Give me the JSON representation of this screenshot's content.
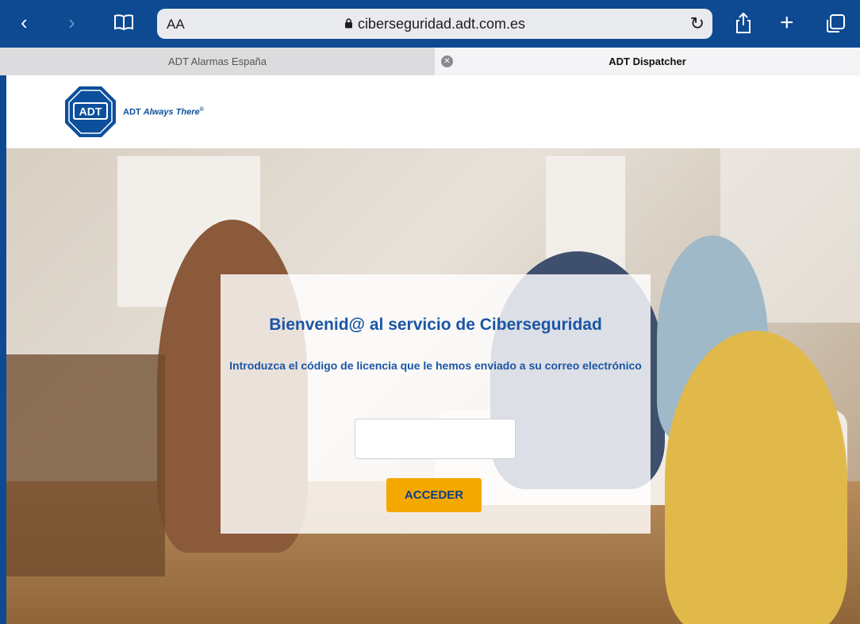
{
  "browser": {
    "text_size_label": "AA",
    "url": "ciberseguridad.adt.com.es",
    "tabs": [
      {
        "label": "ADT Alarmas España",
        "active": false
      },
      {
        "label": "ADT Dispatcher",
        "active": true
      }
    ],
    "icons": [
      "back-icon",
      "forward-icon",
      "bookmarks-icon",
      "lock-icon",
      "reload-icon",
      "share-icon",
      "new-tab-icon",
      "tabs-overview-icon",
      "tab-close-icon"
    ]
  },
  "header": {
    "logo_text": "ADT",
    "tagline_brand": "ADT",
    "tagline_slogan": "Always There",
    "tagline_mark": "®"
  },
  "login": {
    "title": "Bienvenid@ al servicio de Ciberseguridad",
    "instructions": "Introduzca el código de licencia que le hemos enviado a su correo electrónico",
    "code_value": "",
    "code_placeholder": "",
    "submit_label": "ACCEDER"
  },
  "colors": {
    "toolbar": "#0d4a92",
    "brand_blue": "#1b56a6",
    "button": "#f5a800"
  }
}
